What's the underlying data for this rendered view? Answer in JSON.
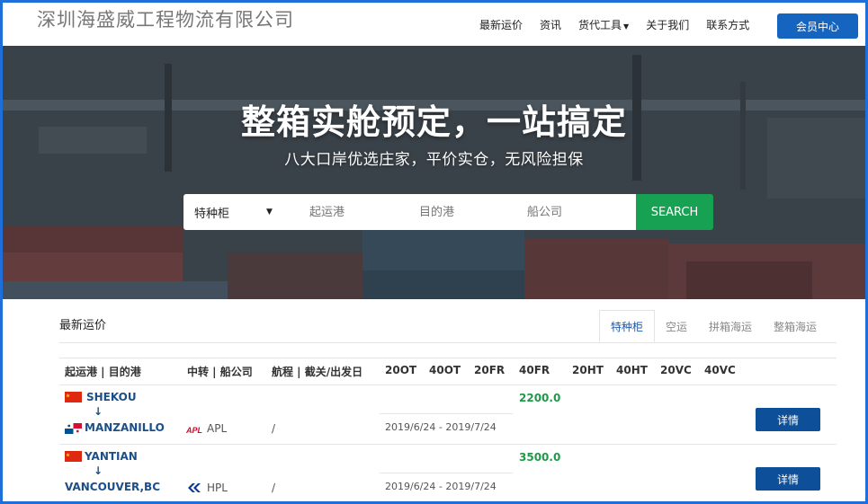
{
  "header": {
    "company_name": "深圳海盛威工程物流有限公司",
    "nav": [
      "最新运价",
      "资讯",
      "货代工具",
      "关于我们",
      "联系方式"
    ],
    "member_button": "会员中心",
    "accent": "#1565c0"
  },
  "hero": {
    "title": "整箱实舱预定，一站搞定",
    "subtitle": "八大口岸优选庄家，平价实仓，无风险担保"
  },
  "search": {
    "select_value": "特种柜",
    "origin_placeholder": "起运港",
    "destination_placeholder": "目的港",
    "carrier_placeholder": "船公司",
    "button": "SEARCH",
    "button_color": "#17a152"
  },
  "rates": {
    "title": "最新运价",
    "tabs": [
      "特种柜",
      "空运",
      "拼箱海运",
      "整箱海运"
    ],
    "active_tab": "特种柜",
    "columns": [
      "起运港 | 目的港",
      "中转 | 船公司",
      "航程 | 截关/出发日",
      "20OT",
      "40OT",
      "20FR",
      "40FR",
      "20HT",
      "40HT",
      "20VC",
      "40VC"
    ],
    "rows": [
      {
        "origin": "SHEKOU",
        "destination": "MANZANILLO",
        "origin_flag": "china-flag",
        "destination_flag": "panama-flag",
        "carrier": "APL",
        "carrier_icon": "apl-logo",
        "voyage": "/",
        "price_40fr": "2200.0",
        "dates": "2019/6/24 - 2019/7/24",
        "detail": "详情"
      },
      {
        "origin": "YANTIAN",
        "destination": "VANCOUVER,BC",
        "origin_flag": "china-flag",
        "destination_flag": "",
        "carrier": "HPL",
        "carrier_icon": "hapag-lloyd-logo",
        "voyage": "/",
        "price_40fr": "3500.0",
        "dates": "2019/6/24 - 2019/7/24",
        "detail": "详情"
      }
    ]
  }
}
